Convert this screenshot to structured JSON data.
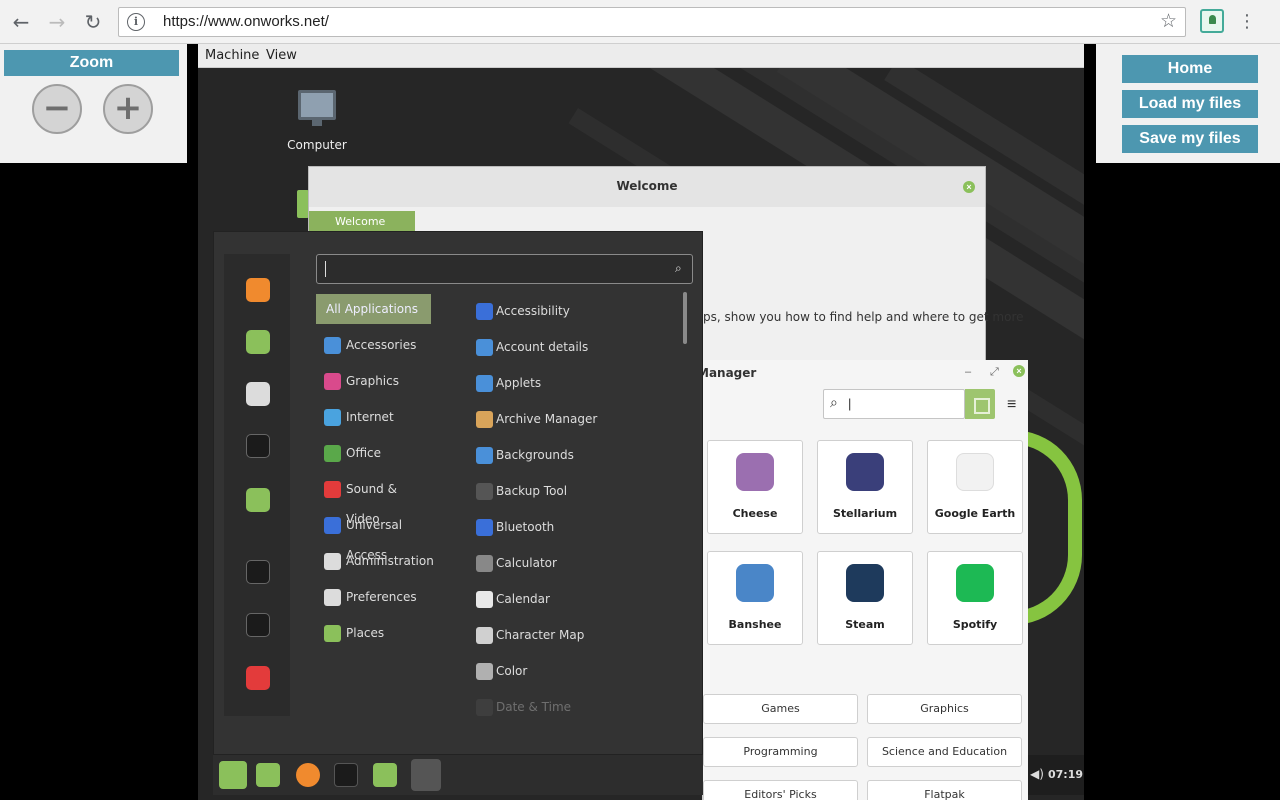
{
  "browser": {
    "url": "https://www.onworks.net/",
    "back_icon": "back-arrow-icon",
    "forward_icon": "forward-arrow-icon",
    "reload_icon": "reload-icon"
  },
  "zoom_panel": {
    "title": "Zoom",
    "minus": "−",
    "plus": "+"
  },
  "right_panel": {
    "home": "Home",
    "load": "Load my files",
    "save": "Save my files"
  },
  "vm_menu": {
    "machine": "Machine",
    "view": "View"
  },
  "desktop": {
    "computer_label": "Computer"
  },
  "welcome": {
    "title": "Welcome",
    "nav_label": "Welcome",
    "body_text": "ps, show you how to find help and where to get more"
  },
  "software_manager": {
    "title_fragment": "Manager",
    "search_value": "|",
    "featured": [
      {
        "name": "Cheese",
        "color": "#9b6fb0"
      },
      {
        "name": "Stellarium",
        "color": "#3a3f7a"
      },
      {
        "name": "Google Earth",
        "color": "#f2f2f2"
      },
      {
        "name": "Banshee",
        "color": "#4a86c8"
      },
      {
        "name": "Steam",
        "color": "#1e3a5c"
      },
      {
        "name": "Spotify",
        "color": "#1db954"
      }
    ],
    "categories": [
      "Games",
      "Graphics",
      "Programming",
      "Science and Education",
      "Editors' Picks",
      "Flatpak"
    ]
  },
  "start_menu": {
    "search_value": "",
    "categories": [
      {
        "label": "All Applications",
        "color": "#8a9b6e"
      },
      {
        "label": "Accessories",
        "color": "#4a90d9"
      },
      {
        "label": "Graphics",
        "color": "#d94a8c"
      },
      {
        "label": "Internet",
        "color": "#4aa3df"
      },
      {
        "label": "Office",
        "color": "#5aa84a"
      },
      {
        "label": "Sound & Video",
        "color": "#e33b3b"
      },
      {
        "label": "Universal Access",
        "color": "#3a6fd9"
      },
      {
        "label": "Administration",
        "color": "#dcdcdc"
      },
      {
        "label": "Preferences",
        "color": "#dcdcdc"
      },
      {
        "label": "Places",
        "color": "#8bc05b"
      }
    ],
    "apps": [
      {
        "label": "Accessibility",
        "color": "#3a6fd9"
      },
      {
        "label": "Account details",
        "color": "#4a90d9"
      },
      {
        "label": "Applets",
        "color": "#4a90d9"
      },
      {
        "label": "Archive Manager",
        "color": "#d9a45a"
      },
      {
        "label": "Backgrounds",
        "color": "#4a90d9"
      },
      {
        "label": "Backup Tool",
        "color": "#555555"
      },
      {
        "label": "Bluetooth",
        "color": "#3a6fd9"
      },
      {
        "label": "Calculator",
        "color": "#888888"
      },
      {
        "label": "Calendar",
        "color": "#e8e8e8"
      },
      {
        "label": "Character Map",
        "color": "#d0d0d0"
      },
      {
        "label": "Color",
        "color": "#b0b0b0"
      },
      {
        "label": "Date & Time",
        "color": "#555555"
      }
    ],
    "favorites": [
      "firefox-icon",
      "software-manager-icon",
      "settings-icon",
      "terminal-icon",
      "files-icon",
      "lock-icon",
      "logout-icon",
      "power-icon"
    ]
  },
  "taskbar": {
    "clock": "07:19"
  }
}
